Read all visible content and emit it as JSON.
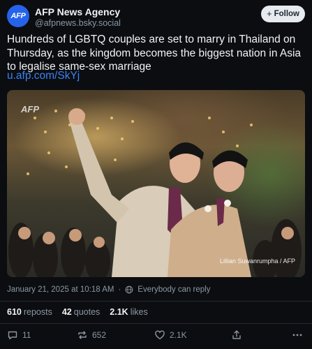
{
  "author": {
    "avatar_text": "AFP",
    "name": "AFP News Agency",
    "handle": "@afpnews.bsky.social",
    "avatar_color": "#2563eb"
  },
  "follow_button": {
    "label": "Follow"
  },
  "post": {
    "text": "Hundreds of LGBTQ couples are set to marry in Thailand on Thursday, as the kingdom becomes the biggest nation in Asia to legalise same-sex marriage",
    "link": "u.afp.com/SkYj",
    "image": {
      "watermark": "AFP",
      "credit": "Lillian Suwanrumpha / AFP"
    },
    "timestamp": "January 21, 2025 at 10:18 AM",
    "reply_setting": "Everybody can reply"
  },
  "stats": {
    "reposts_count": "610",
    "reposts_label": "reposts",
    "quotes_count": "42",
    "quotes_label": "quotes",
    "likes_count": "2.1K",
    "likes_label": "likes"
  },
  "actions": {
    "reply_count": "11",
    "repost_count": "652",
    "like_count": "2.1K"
  },
  "colors": {
    "background": "#0b0d10",
    "link": "#3b82f6",
    "muted": "#8b98a5"
  }
}
